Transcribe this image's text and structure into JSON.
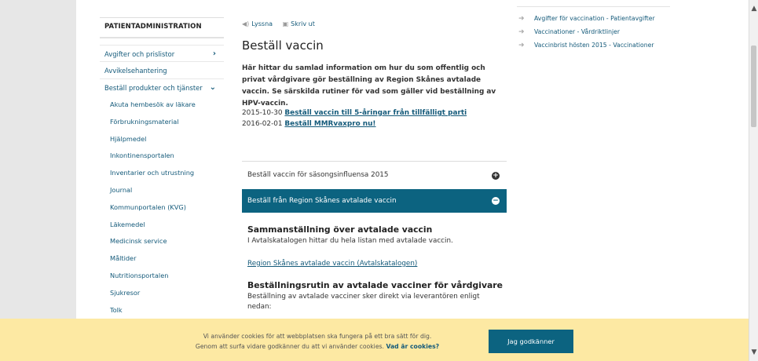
{
  "sidenav": {
    "heading": "PATIENTADMINISTRATION",
    "items": [
      {
        "label": "Avgifter och prislistor",
        "chevron": "›"
      },
      {
        "label": "Avvikelsehantering"
      },
      {
        "label": "Beställ produkter och tjänster",
        "chevron": "⌄"
      }
    ],
    "subitems": [
      "Akuta hembesök av läkare",
      "Förbrukningsmaterial",
      "Hjälpmedel",
      "Inkontinensportalen",
      "Inventarier och utrustning",
      "Journal",
      "Kommunportalen (KVG)",
      "Läkemedel",
      "Medicinsk service",
      "Måltider",
      "Nutritionsportalen",
      "Sjukresor",
      "Tolk"
    ]
  },
  "toolbar": {
    "listen_icon": "◀)",
    "listen_label": "Lyssna",
    "print_icon": "▣",
    "print_label": "Skriv ut"
  },
  "main": {
    "title": "Beställ vaccin",
    "intro": "Här hittar du samlad information om hur du som offentlig och privat vårdgivare gör beställning av Region Skånes avtalade vaccin. Se särskilda rutiner för vad som gäller vid beställning av HPV-vaccin.",
    "news": [
      {
        "date": "2015-10-30",
        "link": "Beställ vaccin till 5-åringar från tillfälligt parti"
      },
      {
        "date": "2016-02-01",
        "link": "Beställ MMRvaxpro nu!"
      }
    ]
  },
  "accordion": {
    "items": [
      {
        "label": "Beställ vaccin för säsongsinfluensa 2015",
        "icon": "+"
      },
      {
        "label": "Beställ från Region Skånes avtalade vaccin",
        "icon": "−"
      }
    ],
    "body": {
      "section1_title": "Sammanställning över avtalade vaccin",
      "section1_text": "I Avtalskatalogen hittar du hela listan med avtalade vaccin.",
      "section1_link": "Region Skånes avtalade vaccin (Avtalskatalogen)",
      "section2_title": "Beställningsrutin av avtalade vacciner för vårdgivare",
      "section2_text": "Beställning av avtalade vacciner sker direkt via leverantören enligt nedan:"
    }
  },
  "related": [
    "Avgifter för vaccination - Patientavgifter",
    "Vaccinationer - Vårdriktlinjer",
    "Vaccinbrist hösten 2015 - Vaccinationer"
  ],
  "cookie": {
    "line1": "Vi använder cookies för att webbplatsen ska fungera på ett bra sätt för dig.",
    "line2": "Genom att surfa vidare godkänner du att vi använder cookies.",
    "link": "Vad är cookies?",
    "button": "Jag godkänner"
  },
  "colors": {
    "accent": "#0c6380",
    "link": "#145a7a",
    "cookie_bg": "#fde9a3"
  }
}
